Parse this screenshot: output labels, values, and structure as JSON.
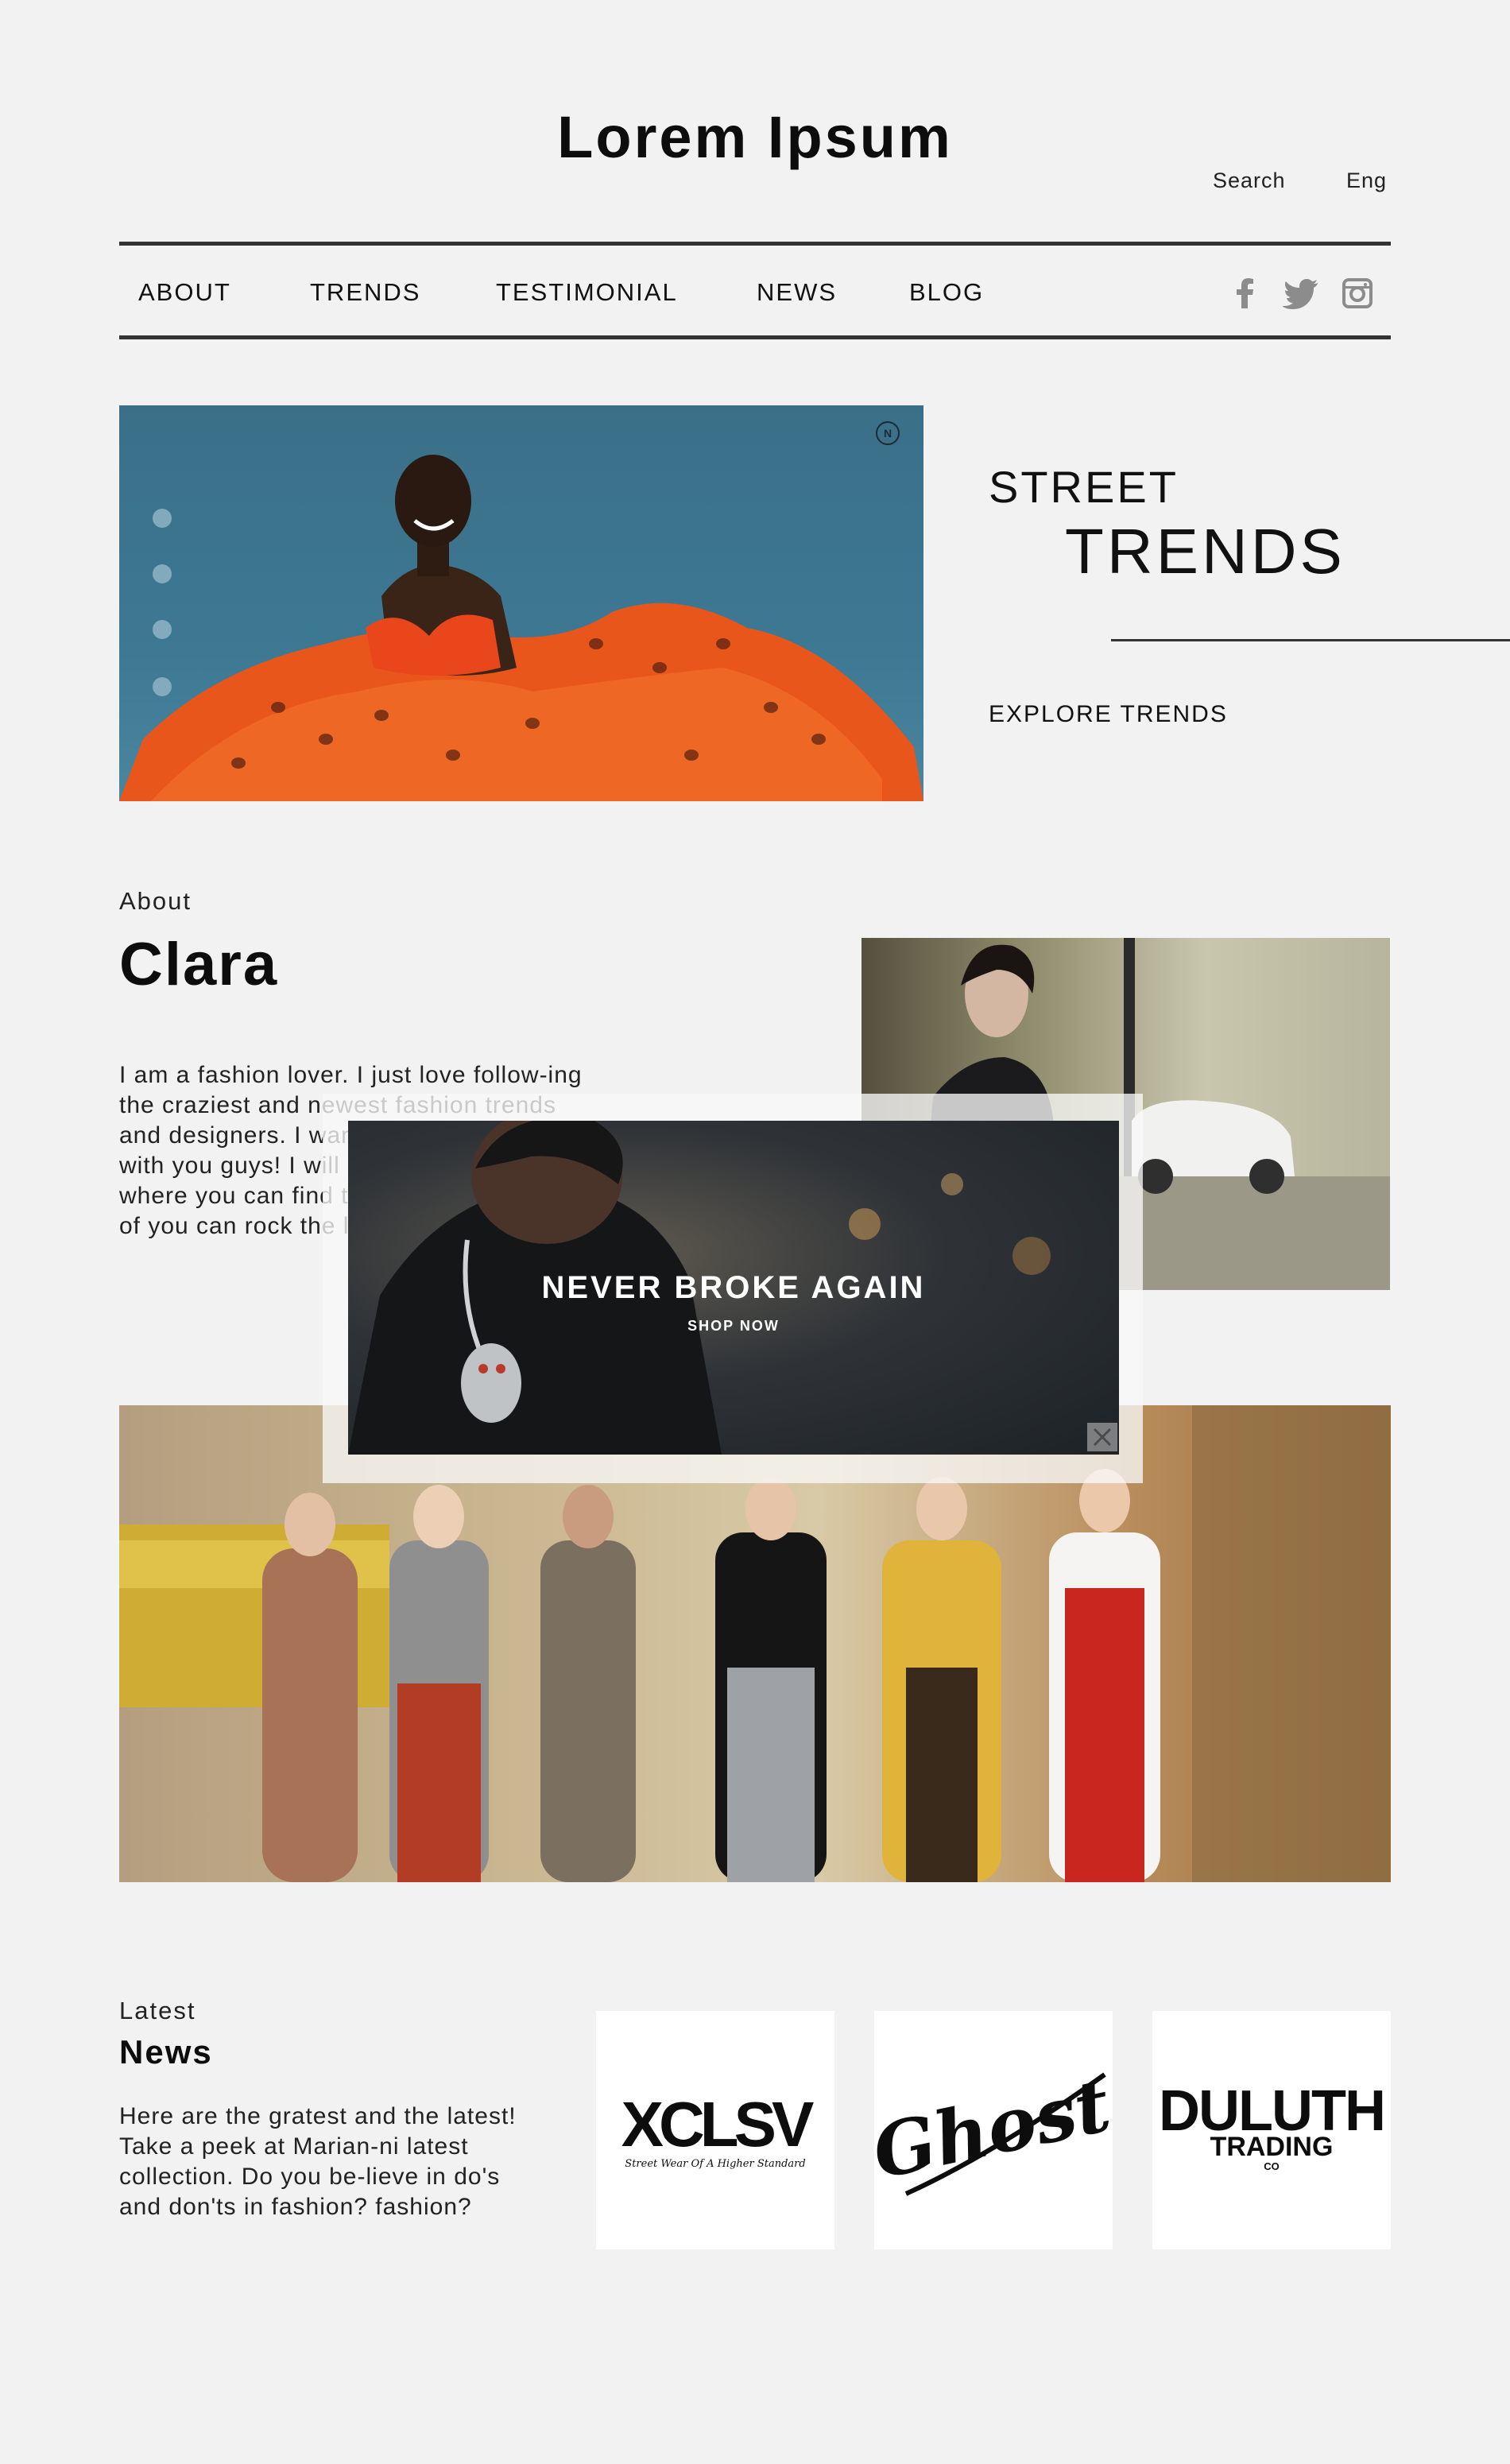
{
  "header": {
    "site_title": "Lorem Ipsum",
    "search_label": "Search",
    "language_label": "Eng"
  },
  "nav": {
    "items": [
      {
        "label": "ABOUT"
      },
      {
        "label": "TRENDS"
      },
      {
        "label": "TESTIMONIAL"
      },
      {
        "label": "NEWS"
      },
      {
        "label": "BLOG"
      }
    ],
    "social_icons": [
      "facebook-icon",
      "twitter-icon",
      "instagram-icon"
    ]
  },
  "hero": {
    "title_line1": "STREET",
    "title_line2": "TRENDS",
    "cta": "EXPLORE TRENDS",
    "badge": "N",
    "slide_count": 4
  },
  "about": {
    "kicker": "About",
    "name": "Clara",
    "body": "I am a fashion lover. I just love follow-ing the craziest and newest fashion trends and designers. I want to share all of them with you guys! I will present the links where you can find the fashion items so all of you can rock the looks in your own way!"
  },
  "popup_ad": {
    "headline": "NEVER BROKE AGAIN",
    "cta": "SHOP NOW"
  },
  "news": {
    "kicker": "Latest",
    "title": "News",
    "body": "Here are the gratest and the latest! Take a peek at Marian-ni latest collection. Do you be-lieve in do's and don'ts in fashion? fashion?",
    "brands": [
      {
        "name": "XCLSV",
        "tagline": "Street Wear Of A Higher Standard"
      },
      {
        "name": "Ghost"
      },
      {
        "name": "DULUTH",
        "line2": "TRADING",
        "line3": "CO"
      }
    ]
  },
  "colors": {
    "background": "#f2f2f2",
    "text": "#111111",
    "rule": "#333333",
    "social_icon": "#8c8c8c",
    "hero_sky": "#3d7893",
    "hero_dress": "#e8561c"
  }
}
